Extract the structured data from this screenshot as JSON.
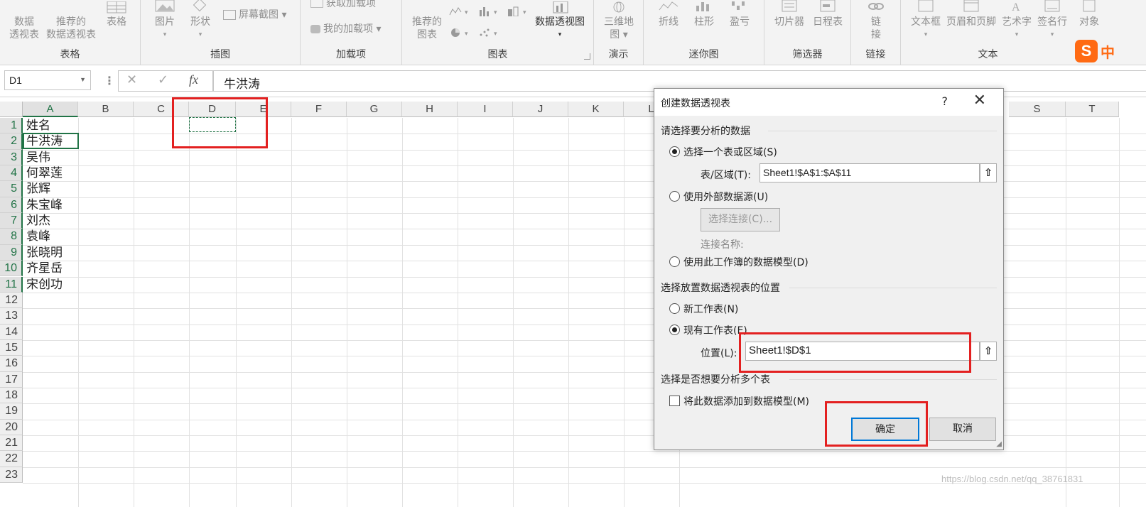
{
  "ribbon": {
    "groups": [
      {
        "name": "表格",
        "buttons": [
          {
            "label1": "数据",
            "label2": "透视表"
          },
          {
            "label1": "推荐的",
            "label2": "数据透视表"
          },
          {
            "label1": "表格",
            "label2": ""
          }
        ]
      },
      {
        "name": "插图",
        "buttons": [
          {
            "label1": "图片",
            "label2": "▾"
          },
          {
            "label1": "形状",
            "label2": "▾"
          }
        ],
        "screenshot": "屏幕截图 ▾"
      },
      {
        "name": "加载项",
        "get_addins": "获取加载项",
        "my_addins": "我的加载项 ▾"
      },
      {
        "name": "图表",
        "recommended1": "推荐的",
        "recommended2": "图表",
        "pivotchart": "数据透视图",
        "pivotchart_arrow": "▾"
      },
      {
        "name": "演示",
        "label1": "三维地",
        "label2": "图 ▾"
      },
      {
        "name": "迷你图",
        "buttons": [
          "折线",
          "柱形",
          "盈亏"
        ]
      },
      {
        "name": "筛选器",
        "buttons": [
          "切片器",
          "日程表"
        ]
      },
      {
        "name": "链接",
        "label1": "链",
        "label2": "接"
      },
      {
        "name": "文本",
        "buttons": [
          "文本框",
          "页眉和页脚",
          "艺术字",
          "签名行",
          "对象"
        ]
      }
    ]
  },
  "formula_bar": {
    "name_box": "D1",
    "cancel_icon": "✕",
    "enter_icon": "✓",
    "fx": "fx",
    "content": "牛洪涛"
  },
  "sheet": {
    "columns": [
      "A",
      "B",
      "C",
      "D",
      "E",
      "F",
      "G",
      "H",
      "I",
      "J",
      "K",
      "L",
      "S",
      "T"
    ],
    "rows": [
      "1",
      "2",
      "3",
      "4",
      "5",
      "6",
      "7",
      "8",
      "9",
      "10",
      "11",
      "12",
      "13",
      "14",
      "15",
      "16",
      "17",
      "18",
      "19",
      "20",
      "21",
      "22",
      "23"
    ],
    "column_a": [
      "姓名",
      "牛洪涛",
      "吴伟",
      "何翠莲",
      "张辉",
      "朱宝峰",
      "刘杰",
      "袁峰",
      "张晓明",
      "齐星岳",
      "宋创功"
    ]
  },
  "dialog": {
    "title": "创建数据透视表",
    "help": "?",
    "close": "✕",
    "section1": "请选择要分析的数据",
    "opt_table": "选择一个表或区域(S)",
    "table_range_label": "表/区域(T):",
    "table_range_value": "Sheet1!$A$1:$A$11",
    "opt_external": "使用外部数据源(U)",
    "choose_connection": "选择连接(C)...",
    "connection_name": "连接名称:",
    "opt_model": "使用此工作簿的数据模型(D)",
    "section2": "选择放置数据透视表的位置",
    "opt_new_sheet": "新工作表(N)",
    "opt_existing_sheet": "现有工作表(E)",
    "location_label": "位置(L):",
    "location_value": "Sheet1!$D$1",
    "section3": "选择是否想要分析多个表",
    "add_to_model": "将此数据添加到数据模型(M)",
    "ok": "确定",
    "cancel": "取消"
  },
  "watermark": "https://blog.csdn.net/qq_38761831",
  "ime": {
    "s": "S",
    "zh": "中"
  },
  "colors": {
    "excel_green": "#217346",
    "highlight_red": "#e32020",
    "focus_blue": "#0078d7"
  }
}
